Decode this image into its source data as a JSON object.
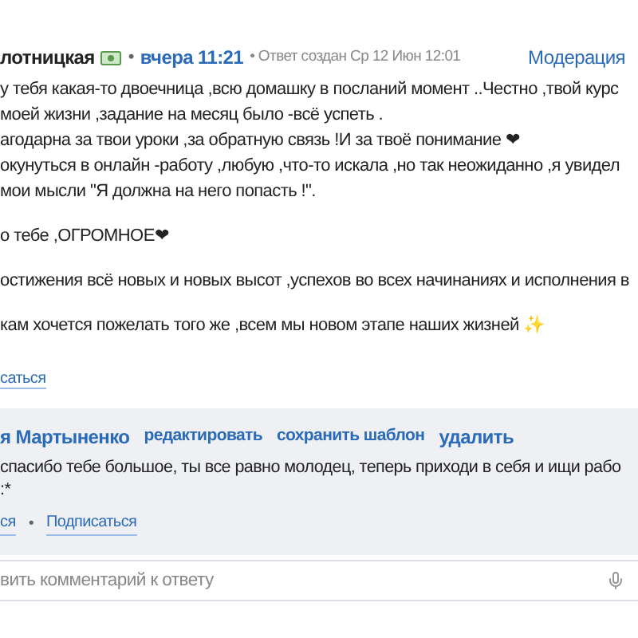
{
  "answer": {
    "author": "лотницкая",
    "dot": "•",
    "time": "вчера 11:21",
    "meta": "• Ответ создан Ср 12 Июн 12:01",
    "moderation": "Модерация",
    "paragraphs": [
      [
        "у тебя какая-то двоечница ,всю домашку в посланий момент ..Честно ,твой курс",
        "моей жизни ,задание на месяц было -всё успеть .",
        "агодарна за твои уроки ,за обратную связь !И за твоё понимание ❤",
        "окунуться в онлайн -работу ,любую ,что-то искала ,но так неожиданно ,я увидел",
        "мои мысли \"Я должна на него попасть !\"."
      ],
      [
        "о тебе ,ОГРОМНОЕ❤"
      ],
      [
        "остижения всё новых и новых высот ,успехов во всех начинаниях и исполнения в"
      ],
      [
        "кам хочется пожелать того же ,всем мы новом этапе наших жизней ✨"
      ]
    ],
    "subscribe": "саться"
  },
  "comment": {
    "author": "я Мартыненко",
    "actions": [
      "редактировать",
      "сохранить шаблон",
      "удалить"
    ],
    "lines": [
      "спасибо тебе большое, ты все равно молодец, теперь приходи в себя и ищи рабо",
      ":*"
    ],
    "links": [
      "ся",
      "Подписаться"
    ],
    "separator": "•"
  },
  "reply_field": {
    "placeholder": "вить комментарий к ответу"
  }
}
